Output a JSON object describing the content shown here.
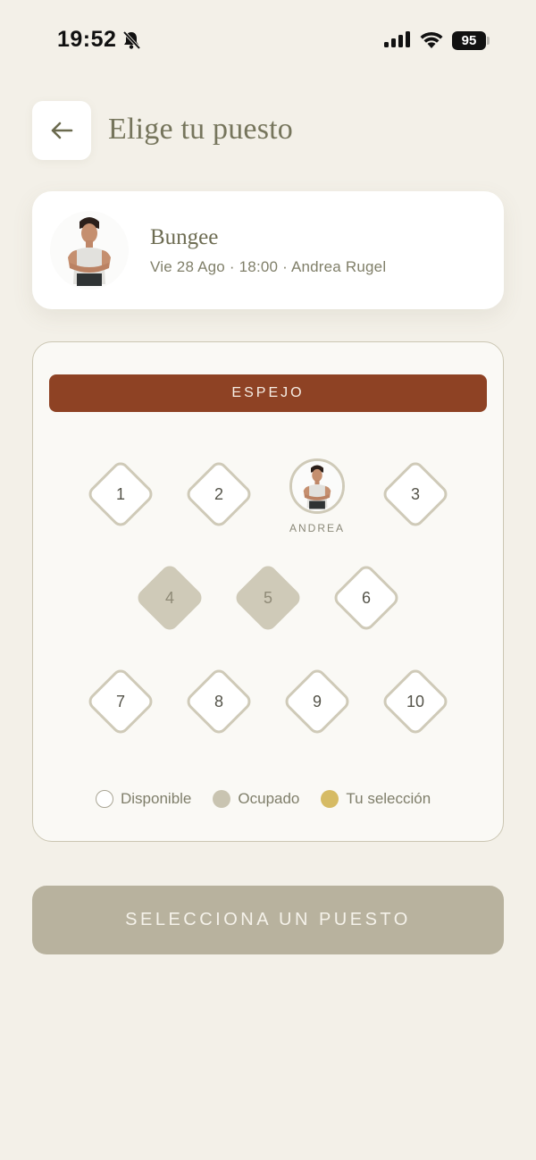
{
  "status_bar": {
    "time": "19:52",
    "battery": "95",
    "icons": [
      "bell-slash-icon",
      "signal-icon",
      "wifi-icon",
      "battery-icon"
    ]
  },
  "header": {
    "title": "Elige tu puesto",
    "back_icon": "arrow-left-icon"
  },
  "class_card": {
    "name": "Bungee",
    "meta": "Vie 28 Ago · 18:00 · Andrea Rugel"
  },
  "room": {
    "mirror_label": "ESPEJO",
    "trainer_label": "ANDREA",
    "spots": [
      {
        "number": "1",
        "status": "available"
      },
      {
        "number": "2",
        "status": "available"
      },
      {
        "number": "3",
        "status": "available"
      },
      {
        "number": "4",
        "status": "occupied"
      },
      {
        "number": "5",
        "status": "occupied"
      },
      {
        "number": "6",
        "status": "available"
      },
      {
        "number": "7",
        "status": "available"
      },
      {
        "number": "8",
        "status": "available"
      },
      {
        "number": "9",
        "status": "available"
      },
      {
        "number": "10",
        "status": "available"
      }
    ]
  },
  "legend": {
    "available": "Disponible",
    "occupied": "Ocupado",
    "selected": "Tu selección"
  },
  "colors": {
    "background": "#f3f0e8",
    "mirror": "#8e4224",
    "occupied": "#cfcab8",
    "selected": "#d6bb64",
    "cta": "#b8b29e"
  },
  "cta": {
    "label": "SELECCIONA UN PUESTO"
  }
}
